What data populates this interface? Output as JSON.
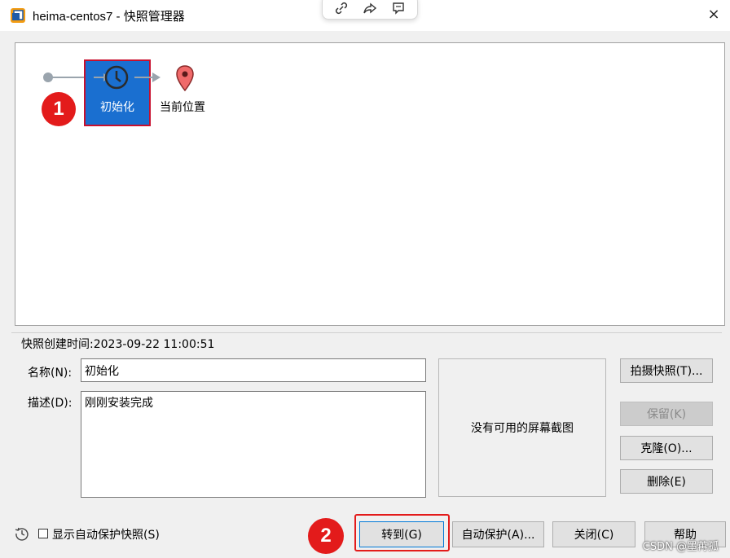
{
  "window": {
    "title": "heima-centos7 - 快照管理器",
    "close_glyph": "×"
  },
  "float_toolbar": {
    "icons": [
      "link-icon",
      "share-icon",
      "comment-icon"
    ]
  },
  "tree": {
    "snapshot_label": "初始化",
    "current_label": "当前位置",
    "badge_1": "1"
  },
  "details": {
    "created": "快照创建时间:2023-09-22 11:00:51",
    "name_label": "名称(N):",
    "name_value": "初始化",
    "desc_label": "描述(D):",
    "desc_value": "刚刚安装完成",
    "no_screenshot": "没有可用的屏幕截图"
  },
  "side_buttons": {
    "take": "拍摄快照(T)...",
    "keep": "保留(K)",
    "clone": "克隆(O)...",
    "delete": "删除(E)"
  },
  "bottom": {
    "autoprotect_checkbox": "显示自动保护快照(S)",
    "badge_2": "2",
    "goto": "转到(G)",
    "autoprotect": "自动保护(A)...",
    "close": "关闭(C)",
    "help": "帮助"
  },
  "watermark": "CSDN @墨苒孤",
  "colors": {
    "selection": "#1a6fd0",
    "highlight": "#e31b1b",
    "pin": "#f06a6a"
  }
}
